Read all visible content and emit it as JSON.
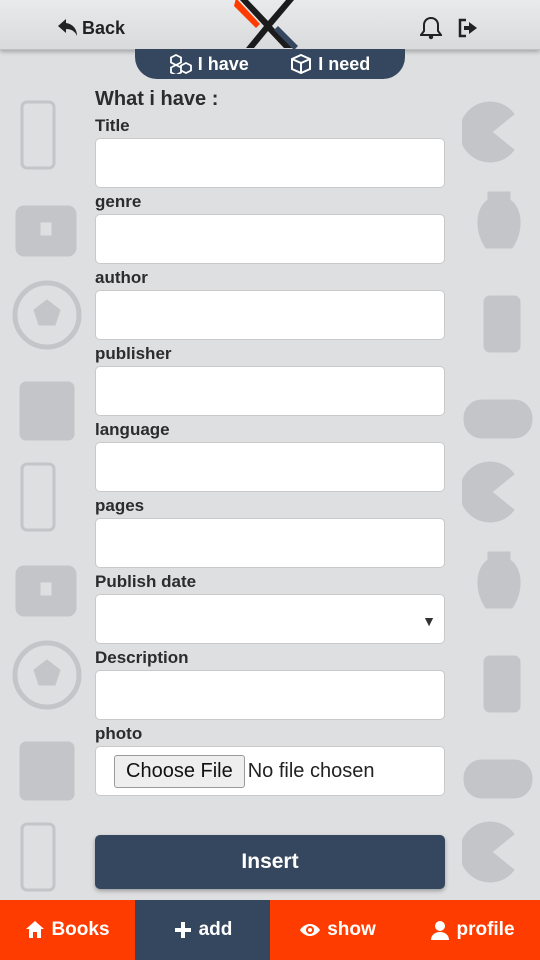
{
  "header": {
    "back_label": "Back",
    "icons": [
      "back-arrow-icon",
      "logo-icon",
      "bell-icon",
      "logout-icon"
    ]
  },
  "toggle": {
    "have_label": "I have",
    "need_label": "I need"
  },
  "form": {
    "heading": "What i have :",
    "labels": {
      "title": "Title",
      "genre": "genre",
      "author": "author",
      "publisher": "publisher",
      "language": "language",
      "pages": "pages",
      "publish_date": "Publish date",
      "description": "Description",
      "photo": "photo"
    },
    "publish_date_value": "",
    "file_button": "Choose File",
    "file_status": "No file chosen",
    "submit_label": "Insert"
  },
  "nav": {
    "items": [
      {
        "label": "Books",
        "icon": "home-icon"
      },
      {
        "label": "add",
        "icon": "plus-icon"
      },
      {
        "label": "show",
        "icon": "eye-icon"
      },
      {
        "label": "profile",
        "icon": "user-icon"
      }
    ],
    "active": "add"
  },
  "colors": {
    "primary": "#34475e",
    "accent": "#ff3c00",
    "background": "#dedfe1"
  }
}
